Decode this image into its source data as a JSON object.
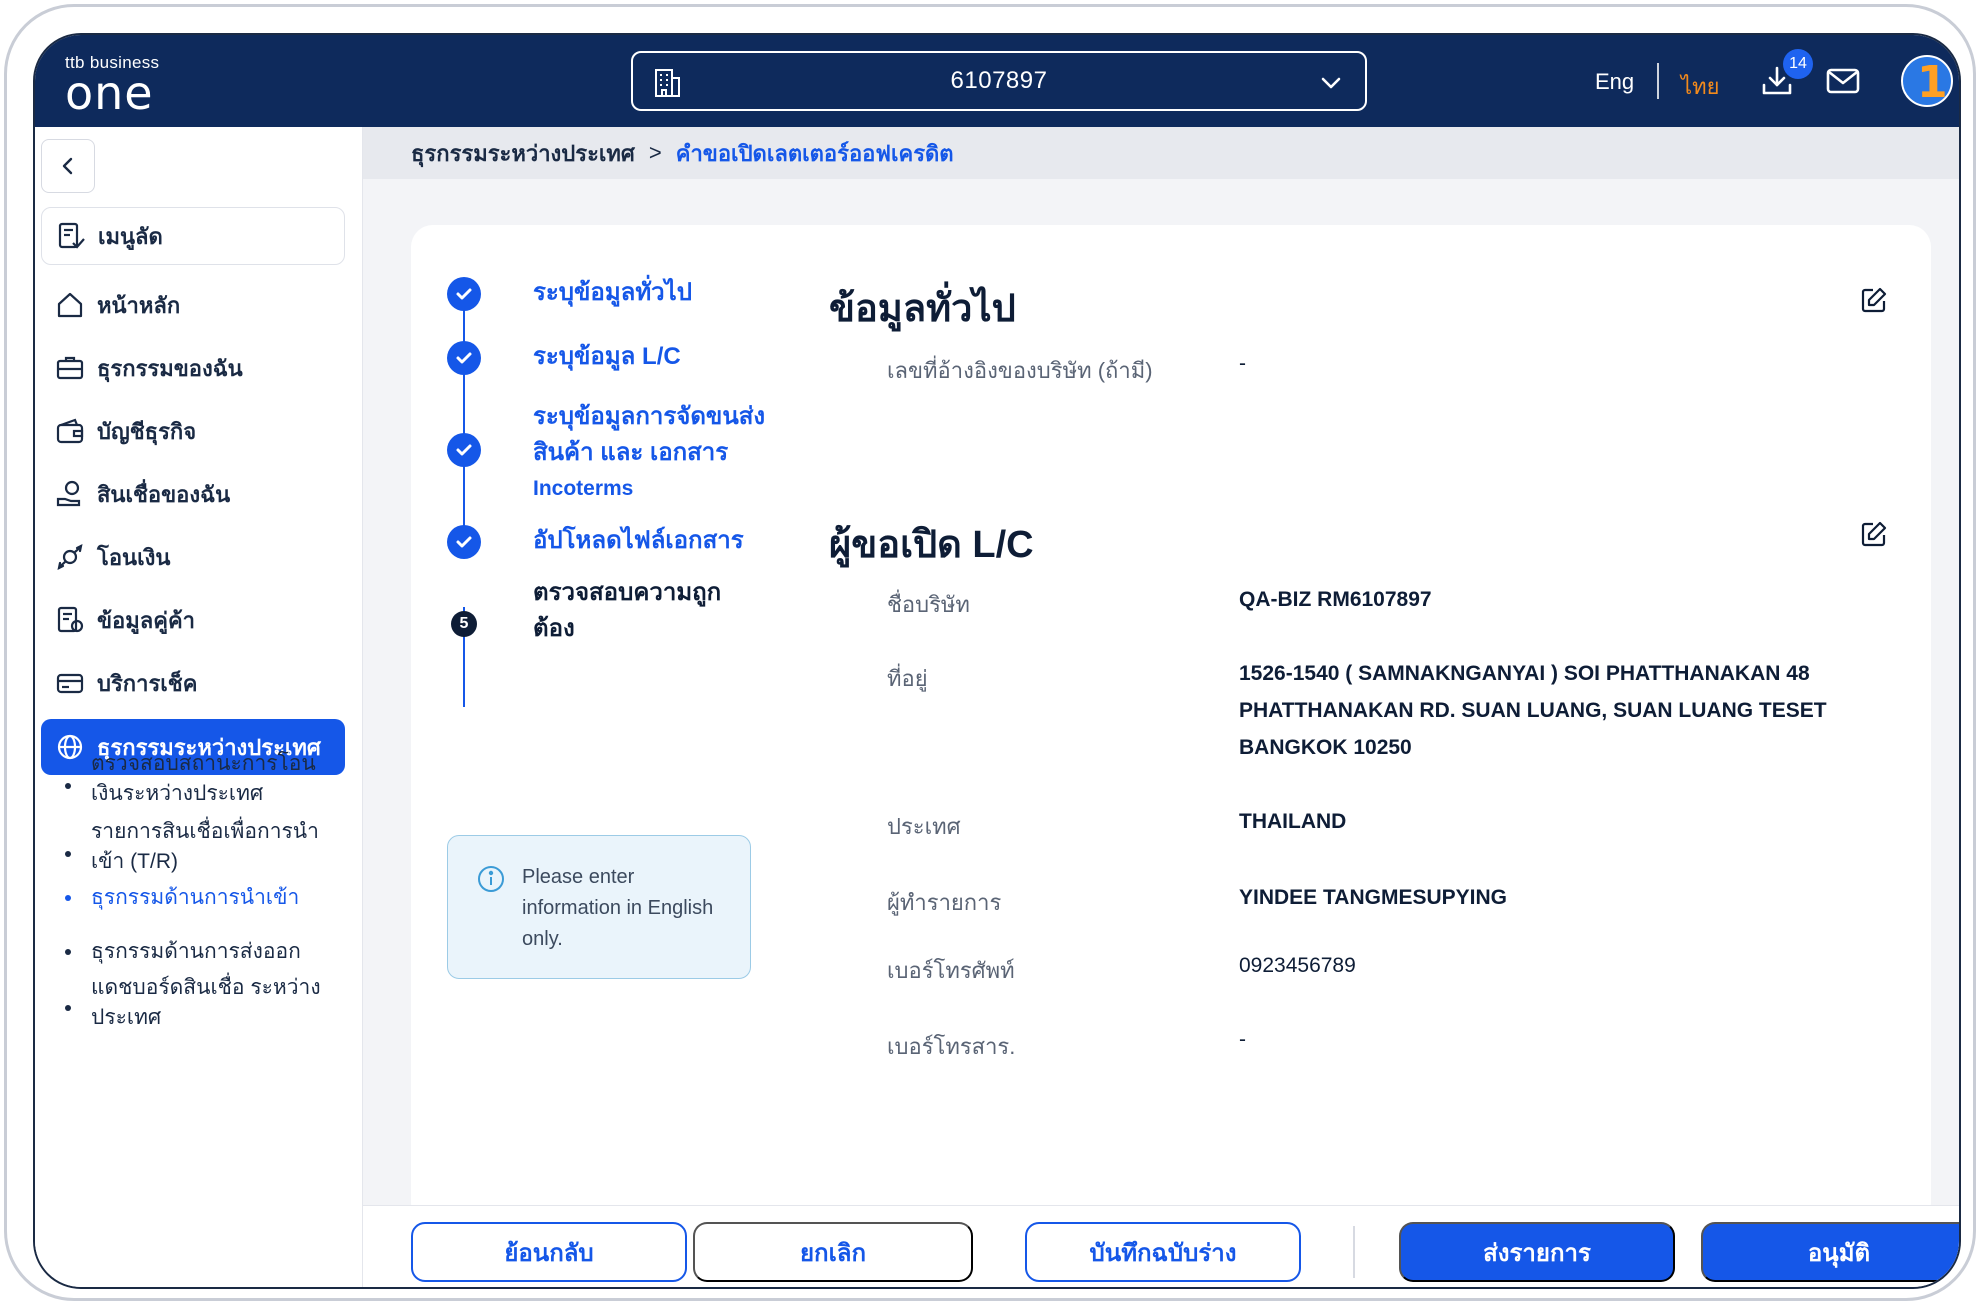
{
  "topbar": {
    "logo_small": "ttb business",
    "logo_big": "one",
    "account_number": "6107897",
    "lang_en": "Eng",
    "lang_th": "ไทย",
    "download_badge": "14"
  },
  "sidebar": {
    "quick_menu": "เมนูลัด",
    "items": [
      {
        "label": "หน้าหลัก"
      },
      {
        "label": "ธุรกรรมของฉัน"
      },
      {
        "label": "บัญชีธุรกิจ"
      },
      {
        "label": "สินเชื่อของฉัน"
      },
      {
        "label": "โอนเงิน"
      },
      {
        "label": "ข้อมูลคู่ค้า"
      },
      {
        "label": "บริการเช็ค"
      },
      {
        "label": "ธุรกรรมระหว่างประเทศ"
      }
    ],
    "subitems": [
      {
        "label": "ตรวจสอบสถานะการโอนเงินระหว่างประเทศ"
      },
      {
        "label": "รายการสินเชื่อเพื่อการนำเข้า (T/R)"
      },
      {
        "label": "ธุรกรรมด้านการนำเข้า"
      },
      {
        "label": "ธุรกรรมด้านการส่งออก"
      },
      {
        "label": "แดชบอร์ดสินเชื่อ ระหว่างประเทศ"
      }
    ]
  },
  "breadcrumb": {
    "parent": "ธุรกรรมระหว่างประเทศ",
    "separator": ">",
    "current": "คำขอเปิดเลตเตอร์ออฟเครดิต"
  },
  "stepper": {
    "steps": [
      {
        "label": "ระบุข้อมูลทั่วไป"
      },
      {
        "label": "ระบุข้อมูล L/C"
      },
      {
        "label": "ระบุข้อมูลการจัดขนส่งสินค้า และ เอกสาร",
        "sub": "Incoterms"
      },
      {
        "label": "อัปโหลดไฟล์เอกสาร"
      },
      {
        "label": "ตรวจสอบความถูกต้อง",
        "number": "5"
      }
    ],
    "info": "Please enter information in English only."
  },
  "general": {
    "title": "ข้อมูลทั่วไป",
    "ref_label": "เลขที่อ้างอิงของบริษัท (ถ้ามี)",
    "ref_value": "-"
  },
  "applicant": {
    "title": "ผู้ขอเปิด L/C",
    "company_label": "ชื่อบริษัท",
    "company_value": "QA-BIZ RM6107897",
    "address_label": "ที่อยู่",
    "address_line1": "1526-1540 ( SAMNAKNGANYAI ) SOI PHATTHANAKAN 48",
    "address_line2": "PHATTHANAKAN RD. SUAN LUANG, SUAN LUANG TESET",
    "address_line3": "BANGKOK 10250",
    "country_label": "ประเทศ",
    "country_value": "THAILAND",
    "maker_label": "ผู้ทำรายการ",
    "maker_value": "YINDEE TANGMESUPYING",
    "phone_label": "เบอร์โทรศัพท์",
    "phone_value": "0923456789",
    "fax_label": "เบอร์โทรสาร.",
    "fax_value": "-"
  },
  "footer": {
    "back": "ย้อนกลับ",
    "cancel": "ยกเลิก",
    "save_draft": "บันทึกฉบับร่าง",
    "submit": "ส่งรายการ",
    "approve": "อนุมัติ"
  },
  "colors": {
    "navy": "#0e2a5c",
    "primary": "#1557e8",
    "accent_orange": "#f28a1c"
  }
}
